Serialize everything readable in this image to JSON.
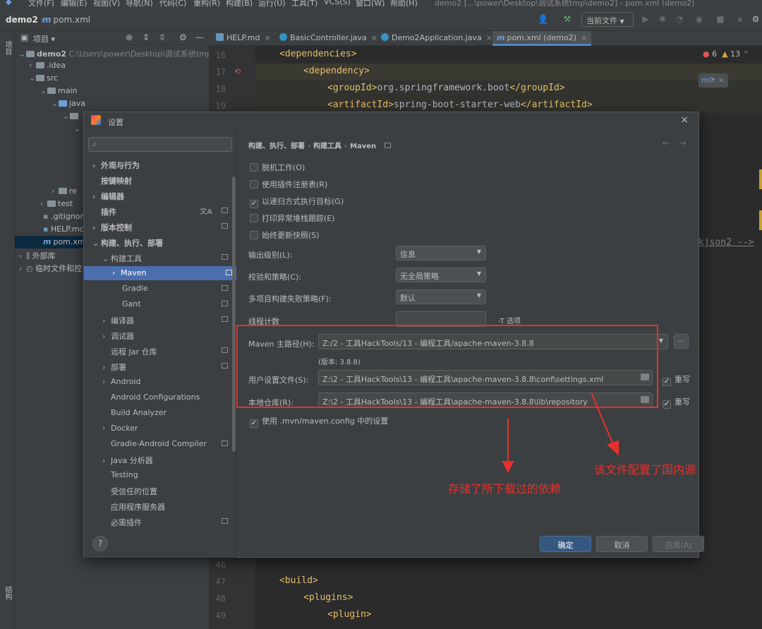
{
  "menubar": {
    "items": [
      "文件(F)",
      "编辑(E)",
      "视图(V)",
      "导航(N)",
      "代码(C)",
      "重构(R)",
      "构建(B)",
      "运行(U)",
      "工具(T)",
      "VCS(S)",
      "窗口(W)",
      "帮助(H)"
    ],
    "window_title": "demo2 [...\\power\\Desktop\\调试系统tmp\\demo2] - pom.xml (demo2)"
  },
  "navbar": {
    "project": "demo2",
    "file": "pom.xml",
    "run_config": "当前文件"
  },
  "left_stripe": {
    "project_label": "项目",
    "structure_label": "结构"
  },
  "project_panel": {
    "title": "项目",
    "tree": [
      {
        "label": "demo2",
        "detail": "C:\\Users\\power\\Desktop\\调试系统tmp"
      },
      {
        "label": ".idea"
      },
      {
        "label": "src"
      },
      {
        "label": "main"
      },
      {
        "label": "java"
      },
      {
        "label": "re"
      },
      {
        "label": "test"
      },
      {
        "label": ".gitignor"
      },
      {
        "label": "HELP.mc"
      },
      {
        "label": "pom.xm"
      },
      {
        "label": "外部库"
      },
      {
        "label": "临时文件和控"
      }
    ]
  },
  "editor": {
    "tabs": [
      {
        "label": "HELP.md",
        "color": "#6897bb"
      },
      {
        "label": "BasicController.java",
        "color": "#3592c4"
      },
      {
        "label": "Demo2Application.java",
        "color": "#3592c4"
      },
      {
        "label": "pom.xml (demo2)",
        "color": "#6f9fd8"
      }
    ],
    "inspections": {
      "errors": "6",
      "warnings": "13"
    },
    "lines_top": [
      {
        "n": "16",
        "code": "<dependencies>"
      },
      {
        "n": "17",
        "code": "<dependency>"
      },
      {
        "n": "18",
        "code_open": "<groupId>",
        "code_text": "org.springframework.boot",
        "code_close": "</groupId>"
      },
      {
        "n": "19",
        "code_open": "<artifactId>",
        "code_text": "spring-boot-starter-web",
        "code_close": "</artifactId>"
      }
    ],
    "right_fragment": "kjson2 -->",
    "lines_bottom": [
      {
        "n": "46",
        "code": ""
      },
      {
        "n": "47",
        "code": "<build>"
      },
      {
        "n": "48",
        "code": "<plugins>"
      },
      {
        "n": "49",
        "code": "<plugin>"
      }
    ]
  },
  "dialog": {
    "title": "设置",
    "search_icon": "search-icon",
    "nav": [
      {
        "label": "外观与行为",
        "expand": "›",
        "bold": true
      },
      {
        "label": "按键映射",
        "expand": "",
        "bold": true
      },
      {
        "label": "编辑器",
        "expand": "›",
        "bold": true
      },
      {
        "label": "插件",
        "expand": "",
        "bold": true
      },
      {
        "label": "版本控制",
        "expand": "›",
        "bold": true
      },
      {
        "label": "构建、执行、部署",
        "expand": "⌄",
        "bold": true
      },
      {
        "label": "构建工具",
        "expand": "⌄"
      },
      {
        "label": "Maven",
        "expand": "›",
        "selected": true
      },
      {
        "label": "Gradle",
        "expand": ""
      },
      {
        "label": "Gant",
        "expand": ""
      },
      {
        "label": "编译器",
        "expand": "›"
      },
      {
        "label": "调试器",
        "expand": "›"
      },
      {
        "label": "远程 Jar 仓库",
        "expand": ""
      },
      {
        "label": "部署",
        "expand": "›"
      },
      {
        "label": "Android",
        "expand": "›"
      },
      {
        "label": "Android Configurations",
        "expand": ""
      },
      {
        "label": "Build Analyzer",
        "expand": ""
      },
      {
        "label": "Docker",
        "expand": "›"
      },
      {
        "label": "Gradle-Android Compiler",
        "expand": ""
      },
      {
        "label": "Java 分析器",
        "expand": "›"
      },
      {
        "label": "Testing",
        "expand": ""
      },
      {
        "label": "受信任的位置",
        "expand": ""
      },
      {
        "label": "应用程序服务器",
        "expand": ""
      },
      {
        "label": "必需插件",
        "expand": ""
      }
    ],
    "breadcrumb": [
      "构建、执行、部署",
      "构建工具",
      "Maven"
    ],
    "checkboxes": [
      {
        "label": "脱机工作(O)",
        "checked": false
      },
      {
        "label": "使用插件注册表(R)",
        "checked": false
      },
      {
        "label": "以递归方式执行目标(G)",
        "checked": true
      },
      {
        "label": "打印异常堆栈跟踪(E)",
        "checked": false
      },
      {
        "label": "始终更新快照(S)",
        "checked": false
      }
    ],
    "output_level": {
      "label": "输出级别(L):",
      "value": "信息"
    },
    "checksum_policy": {
      "label": "校验和策略(C):",
      "value": "无全局策略"
    },
    "failure_policy": {
      "label": "多项目构建失败策略(F):",
      "value": "默认"
    },
    "threads": {
      "label": "线程计数",
      "note": "-T 选项"
    },
    "maven_home": {
      "label": "Maven 主路径(H):",
      "value": "Z:/2 - 工具HackTools/13 - 编程工具/apache-maven-3.8.8",
      "version": "(版本: 3.8.8)",
      "browse": "..."
    },
    "user_settings": {
      "label": "用户设置文件(S):",
      "value": "Z:\\2 - 工具HackTools\\13 - 编程工具\\apache-maven-3.8.8\\conf\\settings.xml",
      "override": "重写"
    },
    "local_repo": {
      "label": "本地仓库(R):",
      "value": "Z:\\2 - 工具HackTools\\13 - 编程工具\\apache-maven-3.8.8\\lib\\repository",
      "override": "重写"
    },
    "use_mvn_config": {
      "label": "使用 .mvn/maven.config 中的设置",
      "checked": true
    },
    "buttons": {
      "ok": "确定",
      "cancel": "取消",
      "apply": "应用(A)"
    },
    "help": "?"
  },
  "annotations": {
    "repo_note": "存储了所下载过的依赖",
    "settings_note": "该文件配置了国内源",
    "color": "#e8302a"
  }
}
